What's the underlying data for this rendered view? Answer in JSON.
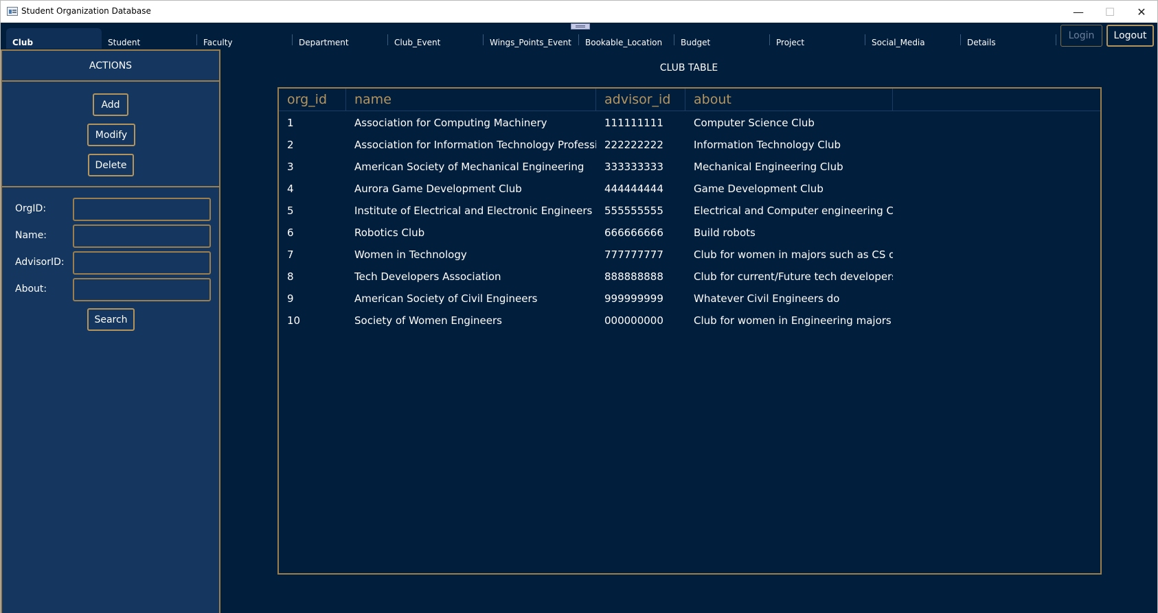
{
  "window": {
    "title": "Student Organization Database",
    "controls": {
      "minimize": "—",
      "maximize": "☐",
      "close": "✕"
    }
  },
  "tabs": [
    {
      "label": "Club",
      "active": true
    },
    {
      "label": "Student"
    },
    {
      "label": "Faculty"
    },
    {
      "label": "Department"
    },
    {
      "label": "Club_Event"
    },
    {
      "label": "Wings_Points_Event"
    },
    {
      "label": "Bookable_Location"
    },
    {
      "label": "Budget"
    },
    {
      "label": "Project"
    },
    {
      "label": "Social_Media"
    },
    {
      "label": "Details"
    }
  ],
  "auth": {
    "login": "Login",
    "logout": "Logout"
  },
  "sidebar": {
    "header": "ACTIONS",
    "add": "Add",
    "modify": "Modify",
    "delete": "Delete",
    "fields": {
      "orgid": {
        "label": "OrgID:",
        "value": ""
      },
      "name": {
        "label": "Name:",
        "value": ""
      },
      "advisorid": {
        "label": "AdvisorID:",
        "value": ""
      },
      "about": {
        "label": "About:",
        "value": ""
      }
    },
    "search": "Search"
  },
  "table": {
    "title": "CLUB TABLE",
    "columns": [
      "org_id",
      "name",
      "advisor_id",
      "about"
    ],
    "rows": [
      [
        "1",
        "Association for Computing Machinery",
        "111111111",
        "Computer Science Club"
      ],
      [
        "2",
        "Association for Information Technology Professiona",
        "222222222",
        "Information Technology Club"
      ],
      [
        "3",
        "American Society of Mechanical Engineering",
        "333333333",
        "Mechanical Engineering Club"
      ],
      [
        "4",
        "Aurora Game Development Club",
        "444444444",
        "Game Development Club"
      ],
      [
        "5",
        "Institute of Electrical and Electronic Engineers",
        "555555555",
        "Electrical and Computer engineering Club"
      ],
      [
        "6",
        "Robotics Club",
        "666666666",
        "Build robots"
      ],
      [
        "7",
        "Women in Technology",
        "777777777",
        "Club for women in majors such as CS or IT"
      ],
      [
        "8",
        "Tech Developers Association",
        "888888888",
        "Club for current/Future tech developers"
      ],
      [
        "9",
        "American Society of Civil Engineers",
        "999999999",
        "Whatever Civil Engineers do"
      ],
      [
        "10",
        "Society of Women Engineers",
        "000000000",
        "Club for women in Engineering majors"
      ]
    ]
  },
  "colors": {
    "background": "#021e3d",
    "panel": "#14365f",
    "accent": "#b4955e",
    "text": "#ffffff"
  },
  "icons": {
    "app": "app-window-icon",
    "drag": "drag-handle-icon"
  }
}
